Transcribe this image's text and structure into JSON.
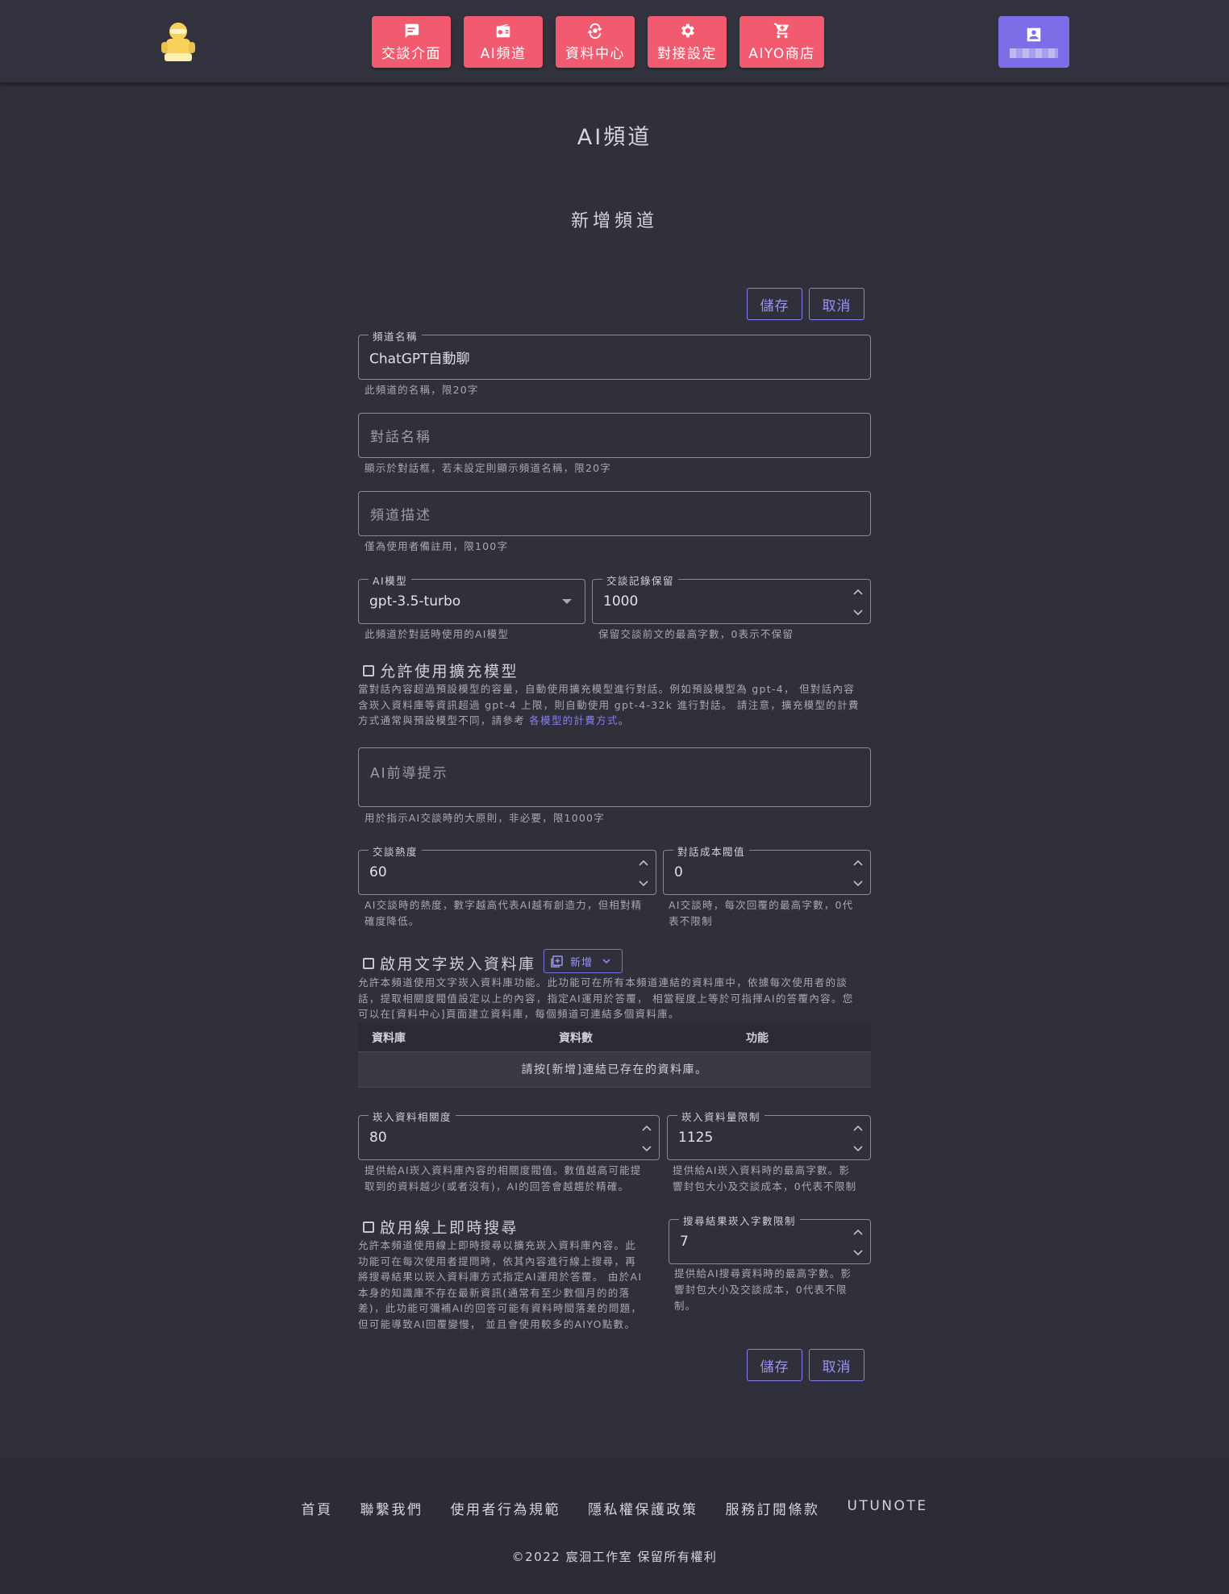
{
  "nav": {
    "items": [
      {
        "label": "交談介面",
        "icon": "chat-icon"
      },
      {
        "label": "AI頻道",
        "icon": "radio-icon"
      },
      {
        "label": "資料中心",
        "icon": "data-center-icon"
      },
      {
        "label": "對接設定",
        "icon": "gear-icon"
      },
      {
        "label": "AIYO商店",
        "icon": "cart-icon"
      }
    ],
    "accent": "#f25b6f",
    "user_accent": "#7d6ee8"
  },
  "page": {
    "title": "AI頻道",
    "subtitle": "新增頻道"
  },
  "actions": {
    "save": "儲存",
    "cancel": "取消"
  },
  "form": {
    "channel_name": {
      "label": "頻道名稱",
      "value": "ChatGPT自動聊",
      "help": "此頻道的名稱，限20字"
    },
    "dialog_name": {
      "placeholder": "對話名稱",
      "help": "顯示於對話框，若未設定則顯示頻道名稱，限20字"
    },
    "channel_desc": {
      "placeholder": "頻道描述",
      "help": "僅為使用者備註用，限100字"
    },
    "ai_model": {
      "label": "AI模型",
      "value": "gpt-3.5-turbo",
      "help": "此頻道於對話時使用的AI模型"
    },
    "history_keep": {
      "label": "交談記錄保留",
      "value": "1000",
      "help": "保留交談前文的最高字數，0表示不保留"
    },
    "extended_model": {
      "label": "允許使用擴充模型",
      "desc_1": "當對話內容超過預設模型的容量，自動使用擴充模型進行對話。例如預設模型為 gpt-4， 但對話內容",
      "desc_2": "含崁入資料庫等資訊超過 gpt-4 上限，則自動使用 gpt-4-32k 進行對話。 請注意，擴充模型的計費",
      "desc_3": "方式通常與預設模型不同，請參考 ",
      "link": "各模型的計費方式",
      "desc_end": "。"
    },
    "system_prompt": {
      "placeholder": "AI前導提示",
      "help": "用於指示AI交談時的大原則，非必要，限1000字"
    },
    "temperature": {
      "label": "交談熱度",
      "value": "60",
      "help_1": "AI交談時的熱度，數字越高代表AI越有創造力，但相對精",
      "help_2": "確度降低。"
    },
    "cost_threshold": {
      "label": "對話成本閥值",
      "value": "0",
      "help_1": "AI交談時，每次回覆的最高字數，0代",
      "help_2": "表不限制"
    },
    "embed_db": {
      "label": "啟用文字崁入資料庫",
      "add_label": "新增",
      "desc_1": "允許本頻道使用文字崁入資料庫功能。此功能可在所有本頻道連結的資料庫中，依據每次使用者的談",
      "desc_2": "話，提取相關度閥值設定以上的內容，指定AI運用於答覆， 相當程度上等於可指揮AI的答覆內容。您",
      "desc_3": "可以在[資料中心]頁面建立資料庫，每個頻道可連結多個資料庫。",
      "columns": [
        "資料庫",
        "資料數",
        "功能"
      ],
      "empty": "請按[新增]連結已存在的資料庫。"
    },
    "embed_relevance": {
      "label": "崁入資料相關度",
      "value": "80",
      "help_1": "提供給AI崁入資料庫內容的相關度閥值。數值越高可能提",
      "help_2": "取到的資料越少(或者沒有)，AI的回答會越趨於精確。"
    },
    "embed_limit": {
      "label": "崁入資料量限制",
      "value": "1125",
      "help_1": "提供給AI崁入資料時的最高字數。影",
      "help_2": "響封包大小及交談成本，0代表不限制"
    },
    "web_search": {
      "label": "啟用線上即時搜尋",
      "lines": [
        "允許本頻道使用線上即時搜尋以擴充崁入資料庫內容。此",
        "功能可在每次使用者提問時，依其內容進行線上搜尋，再",
        "將搜尋結果以崁入資料庫方式指定AI運用於答覆。 由於AI",
        "本身的知識庫不存在最新資訊(通常有至少數個月的的落",
        "差)，此功能可彌補AI的回答可能有資料時間落差的問題，",
        "但可能導致AI回覆變慢， 並且會使用較多的AIYO點數。"
      ]
    },
    "search_limit": {
      "label": "搜尋結果崁入字數限制",
      "value": "7",
      "help_1": "提供給AI搜尋資料時的最高字數。影",
      "help_2": "響封包大小及交談成本，0代表不限",
      "help_3": "制。"
    }
  },
  "footer": {
    "links": [
      "首頁",
      "聯繫我們",
      "使用者行為規範",
      "隱私權保護政策",
      "服務訂閱條款",
      "UTUNOTE"
    ],
    "copyright": "©2022 宸洄工作室 保留所有權利"
  }
}
